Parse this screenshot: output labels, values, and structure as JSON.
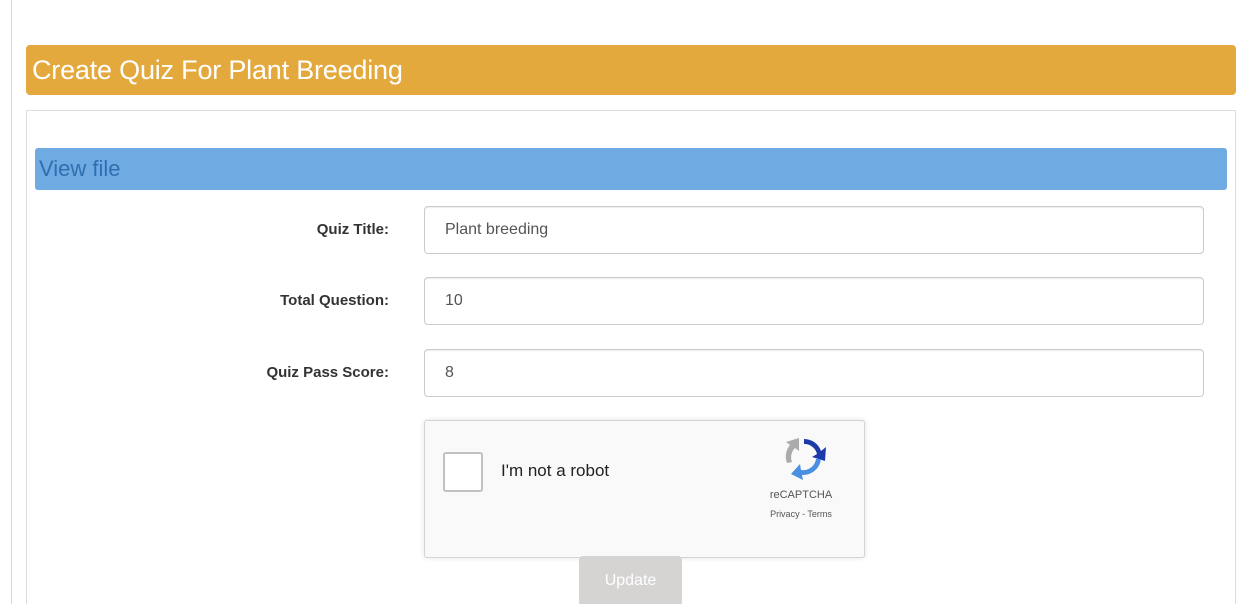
{
  "header": {
    "title": "Create Quiz For Plant Breeding",
    "color": "#e3a93d"
  },
  "section": {
    "title": "View file",
    "color": "#6faae3"
  },
  "form": {
    "quiz_title": {
      "label": "Quiz Title:",
      "value": "Plant breeding"
    },
    "total_question": {
      "label": "Total Question:",
      "value": "10"
    },
    "pass_score": {
      "label": "Quiz Pass Score:",
      "value": "8"
    }
  },
  "captcha": {
    "label": "I'm not a robot",
    "brand": "reCAPTCHA",
    "privacy": "Privacy",
    "separator": " - ",
    "terms": "Terms",
    "icon": "recaptcha-logo-icon"
  },
  "actions": {
    "update_label": "Update",
    "update_color": "#d6d3d3"
  }
}
